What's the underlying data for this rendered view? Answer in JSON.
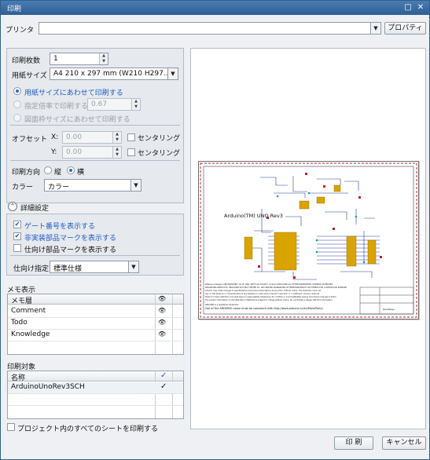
{
  "window": {
    "title": "印刷",
    "maximize_icon": "maximize-icon",
    "close_icon": "close-icon"
  },
  "printer": {
    "label": "プリンタ",
    "value": "",
    "properties_label": "プロパティ"
  },
  "settings": {
    "copies_label": "印刷枚数",
    "copies_value": "1",
    "paper_label": "用紙サイズ",
    "paper_value": "A4 210 x 297 mm (W210 H297...",
    "fit_paper_label": "用紙サイズにあわせて印刷する",
    "scale_label": "指定倍率で印刷する",
    "scale_value": "0.67",
    "fit_frame_label": "図面枠サイズにあわせて印刷する",
    "offset_label": "オフセット",
    "x_label": "X:",
    "x_value": "0.00",
    "y_label": "Y:",
    "y_value": "0.00",
    "center_x_label": "センタリング",
    "center_y_label": "センタリング",
    "orientation_label": "印刷方向",
    "portrait_label": "縦",
    "landscape_label": "横",
    "color_label": "カラー",
    "color_value": "カラー"
  },
  "details": {
    "toggle_label": "詳細設定",
    "gate_label": "ゲート番号を表示する",
    "unmounted_label": "非実装部品マークを表示する",
    "destination_mark_label": "仕向け部品マークを表示する",
    "destination_label": "仕向け指定",
    "destination_value": "標準仕様"
  },
  "memo": {
    "section_label": "メモ表示",
    "header": "メモ層",
    "eye_icon": "eye-icon",
    "rows": [
      {
        "name": "Comment"
      },
      {
        "name": "Todo"
      },
      {
        "name": "Knowledge"
      }
    ]
  },
  "target": {
    "section_label": "印刷対象",
    "header": "名称",
    "check_icon": "check-icon",
    "rows": [
      {
        "name": "ArduinoUnoRev3SCH"
      }
    ]
  },
  "all_sheets_label": "プロジェクト内のすべてのシートを印刷する",
  "preview": {
    "schematic_title": "Arduino(TM) UNO Rev3",
    "notes": [
      "Reference Designs ARE PROVIDED \"AS IS\" AND \"WITH ALL FAULTS\". Arduino DISCLAIMS ALL OTHER WARRANTIES, EXPRESS OR IMPLIED,",
      "REGARDING PRODUCTS, INCLUDING BUT NOT LIMITED TO, ANY IMPLIED WARRANTIES OF MERCHANTABILITY OR FITNESS FOR A PARTICULAR PURPOSE",
      "Arduino may make changes to specifications and product descriptions at any time, without notice. The Customer must not",
      "rely on the absence or characteristics of any features or instructions marked \"reserved\" or \"undefined.\" Arduino reserves",
      "these for future definition and shall have no responsibility whatsoever for conflicts or incompatibilities arising from future changes to them.",
      "The product information on the Web Site or Materials is subject to change without notice. Do not finalize a design with this information.",
      "ARDUINO is a registered trademark.",
      "Use of the ARDUINO name must be compliant with http://www.arduino.cc/en/Main/Policy"
    ],
    "title_block_name": "Quadkeys"
  },
  "buttons": {
    "print": "印 刷",
    "cancel": "キャンセル"
  },
  "colors": {
    "title_bar": "#3a6ea5",
    "accent": "#1d5bc4",
    "preview_border": "#c0202a"
  }
}
